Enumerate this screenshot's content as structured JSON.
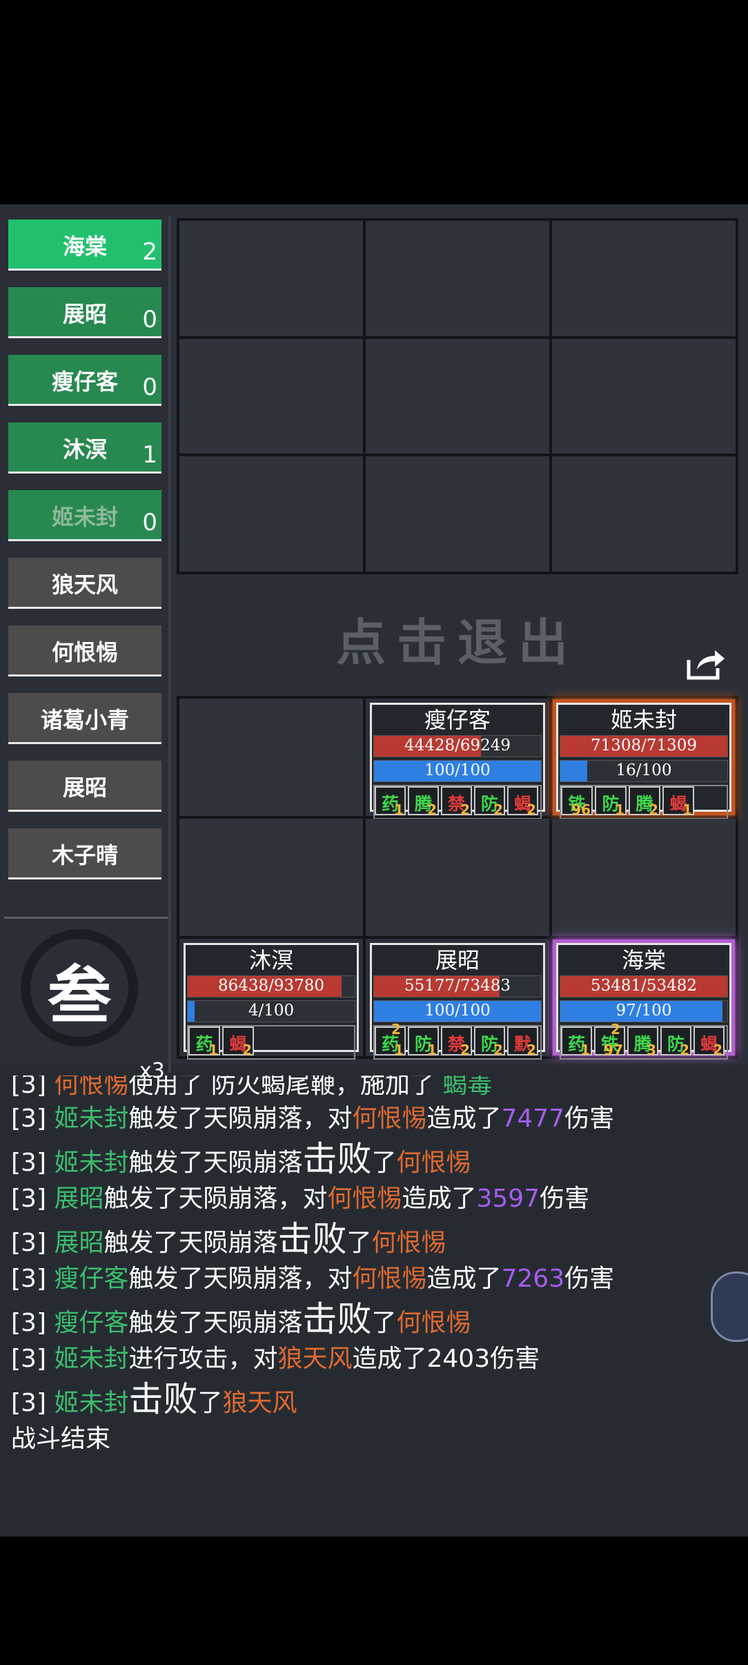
{
  "roster": [
    {
      "name": "海棠",
      "count": "2",
      "side": "ally",
      "active": true
    },
    {
      "name": "展昭",
      "count": "0",
      "side": "ally"
    },
    {
      "name": "瘦仔客",
      "count": "0",
      "side": "ally"
    },
    {
      "name": "沐溟",
      "count": "1",
      "side": "ally"
    },
    {
      "name": "姬未封",
      "count": "0",
      "side": "ally",
      "dim": true
    },
    {
      "name": "狼天风",
      "count": "",
      "side": "enemy"
    },
    {
      "name": "何恨惕",
      "count": "",
      "side": "enemy"
    },
    {
      "name": "诸葛小青",
      "count": "",
      "side": "enemy"
    },
    {
      "name": "展昭",
      "count": "",
      "side": "enemy"
    },
    {
      "name": "木子晴",
      "count": "",
      "side": "enemy"
    }
  ],
  "emblem": {
    "glyph": "叁",
    "multiplier": "x3"
  },
  "exit_label": "点击退出",
  "units": {
    "shouzaike": {
      "name": "瘦仔客",
      "hp_text": "44428/69249",
      "hp": 0.64,
      "mp_text": "100/100",
      "mp": 1.0,
      "buffs": [
        {
          "b": "药",
          "c": "#3fd84c",
          "n": "1"
        },
        {
          "b": "腾",
          "c": "#3fd84c",
          "n": "2"
        },
        {
          "b": "禁",
          "c": "#e03a3a",
          "n": "2"
        },
        {
          "b": "防",
          "c": "#3fd84c",
          "n": "2"
        },
        {
          "b": "蝎",
          "c": "#e03a3a",
          "n": "2"
        }
      ]
    },
    "jiweifeng": {
      "name": "姬未封",
      "hp_text": "71308/71309",
      "hp": 1.0,
      "mp_text": "16/100",
      "mp": 0.16,
      "buffs": [
        {
          "b": "铁",
          "c": "#3fd84c",
          "n": "96"
        },
        {
          "b": "防",
          "c": "#3fd84c",
          "n": "1"
        },
        {
          "b": "腾",
          "c": "#3fd84c",
          "n": "2"
        },
        {
          "b": "蝎",
          "c": "#e03a3a",
          "n": "1"
        }
      ]
    },
    "muming": {
      "name": "沐溟",
      "hp_text": "86438/93780",
      "hp": 0.92,
      "mp_text": "4/100",
      "mp": 0.04,
      "buffs": [
        {
          "b": "药",
          "c": "#3fd84c",
          "n": "1"
        },
        {
          "b": "蝎",
          "c": "#e03a3a",
          "n": "2"
        }
      ]
    },
    "zhanzhao": {
      "name": "展昭",
      "hp_text": "55177/73483",
      "hp": 0.75,
      "mp_text": "100/100",
      "mp": 1.0,
      "buffs": [
        {
          "b": "药",
          "c": "#3fd84c",
          "n": "1",
          "top": "2"
        },
        {
          "b": "防",
          "c": "#3fd84c",
          "n": "1"
        },
        {
          "b": "禁",
          "c": "#e03a3a",
          "n": "2"
        },
        {
          "b": "防",
          "c": "#3fd84c",
          "n": "2"
        },
        {
          "b": "默",
          "c": "#e03a3a",
          "n": "2"
        }
      ]
    },
    "haitang": {
      "name": "海棠",
      "hp_text": "53481/53482",
      "hp": 1.0,
      "mp_text": "97/100",
      "mp": 0.97,
      "buffs": [
        {
          "b": "药",
          "c": "#3fd84c",
          "n": "1"
        },
        {
          "b": "铁",
          "c": "#3fd84c",
          "n": "97",
          "top": "2"
        },
        {
          "b": "腾",
          "c": "#3fd84c",
          "n": "3"
        },
        {
          "b": "防",
          "c": "#3fd84c",
          "n": "2"
        },
        {
          "b": "蝎",
          "c": "#e03a3a",
          "n": "2"
        }
      ]
    }
  },
  "log": {
    "l0": {
      "r": "[3] ",
      "a": "何恨惕",
      "t": "使用了 防火蝎尾鞭，施加了 ",
      "b": "蝎毒"
    },
    "l1": {
      "r": "[3] ",
      "a": "姬未封",
      "t1": "触发了天陨崩落，对",
      "b": "何恨惕",
      "t2": "造成了",
      "n": "7477",
      "t3": "伤害"
    },
    "l2": {
      "r": "[3] ",
      "a": "姬未封",
      "t1": "触发了天陨崩落",
      "w": "击败",
      "t2": "了",
      "b": "何恨惕"
    },
    "l3": {
      "r": "[3] ",
      "a": "展昭",
      "t1": "触发了天陨崩落，对",
      "b": "何恨惕",
      "t2": "造成了",
      "n": "3597",
      "t3": "伤害"
    },
    "l4": {
      "r": "[3] ",
      "a": "展昭",
      "t1": "触发了天陨崩落",
      "w": "击败",
      "t2": "了",
      "b": "何恨惕"
    },
    "l5": {
      "r": "[3] ",
      "a": "瘦仔客",
      "t1": "触发了天陨崩落，对",
      "b": "何恨惕",
      "t2": "造成了",
      "n": "7263",
      "t3": "伤害"
    },
    "l6": {
      "r": "[3] ",
      "a": "瘦仔客",
      "t1": "触发了天陨崩落",
      "w": "击败",
      "t2": "了",
      "b": "何恨惕"
    },
    "l7": {
      "r": "[3] ",
      "a": "姬未封",
      "t1": "进行攻击，对",
      "b": "狼天风",
      "t2": "造成了2403伤害"
    },
    "l8": {
      "r": "[3] ",
      "a": "姬未封",
      "w": "击败",
      "t2": "了",
      "b": "狼天风"
    },
    "l9": {
      "t": "战斗结束"
    }
  },
  "colors": {
    "ally": "#3bbd6c",
    "enemy": "#e06a2f",
    "damage": "#a55cef",
    "select_orange": "#c7541f",
    "select_purple": "#b55fd2"
  },
  "icons": [
    "share-icon"
  ]
}
